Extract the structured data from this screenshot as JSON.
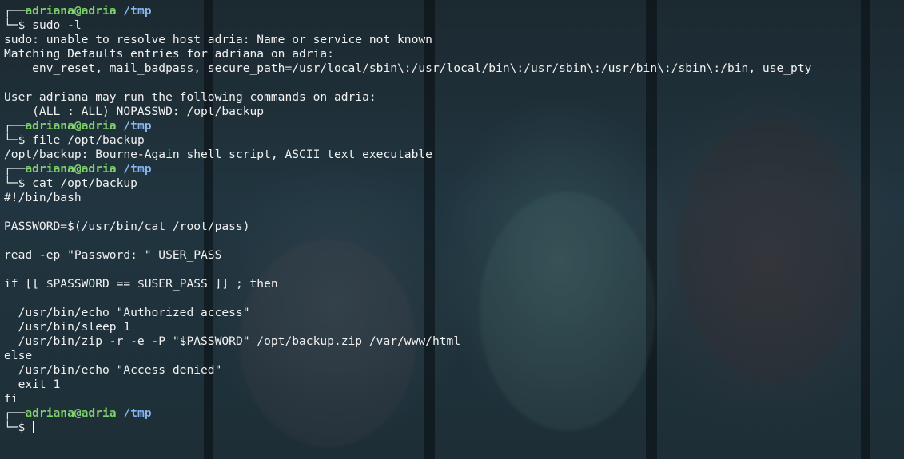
{
  "prompt": {
    "user_host": "adriana@adria",
    "cwd": "/tmp",
    "symbol": "$"
  },
  "blocks": [
    {
      "command": "sudo -l",
      "output": [
        "sudo: unable to resolve host adria: Name or service not known",
        "Matching Defaults entries for adriana on adria:",
        "    env_reset, mail_badpass, secure_path=/usr/local/sbin\\:/usr/local/bin\\:/usr/sbin\\:/usr/bin\\:/sbin\\:/bin, use_pty",
        "",
        "User adriana may run the following commands on adria:",
        "    (ALL : ALL) NOPASSWD: /opt/backup"
      ]
    },
    {
      "command": "file /opt/backup",
      "output": [
        "/opt/backup: Bourne-Again shell script, ASCII text executable"
      ]
    },
    {
      "command": "cat /opt/backup",
      "output": [
        "#!/bin/bash",
        "",
        "PASSWORD=$(/usr/bin/cat /root/pass)",
        "",
        "read -ep \"Password: \" USER_PASS",
        "",
        "if [[ $PASSWORD == $USER_PASS ]] ; then",
        "",
        "  /usr/bin/echo \"Authorized access\"",
        "  /usr/bin/sleep 1",
        "  /usr/bin/zip -r -e -P \"$PASSWORD\" /opt/backup.zip /var/www/html",
        "else",
        "  /usr/bin/echo \"Access denied\"",
        "  exit 1",
        "fi"
      ]
    }
  ],
  "current_input": ""
}
